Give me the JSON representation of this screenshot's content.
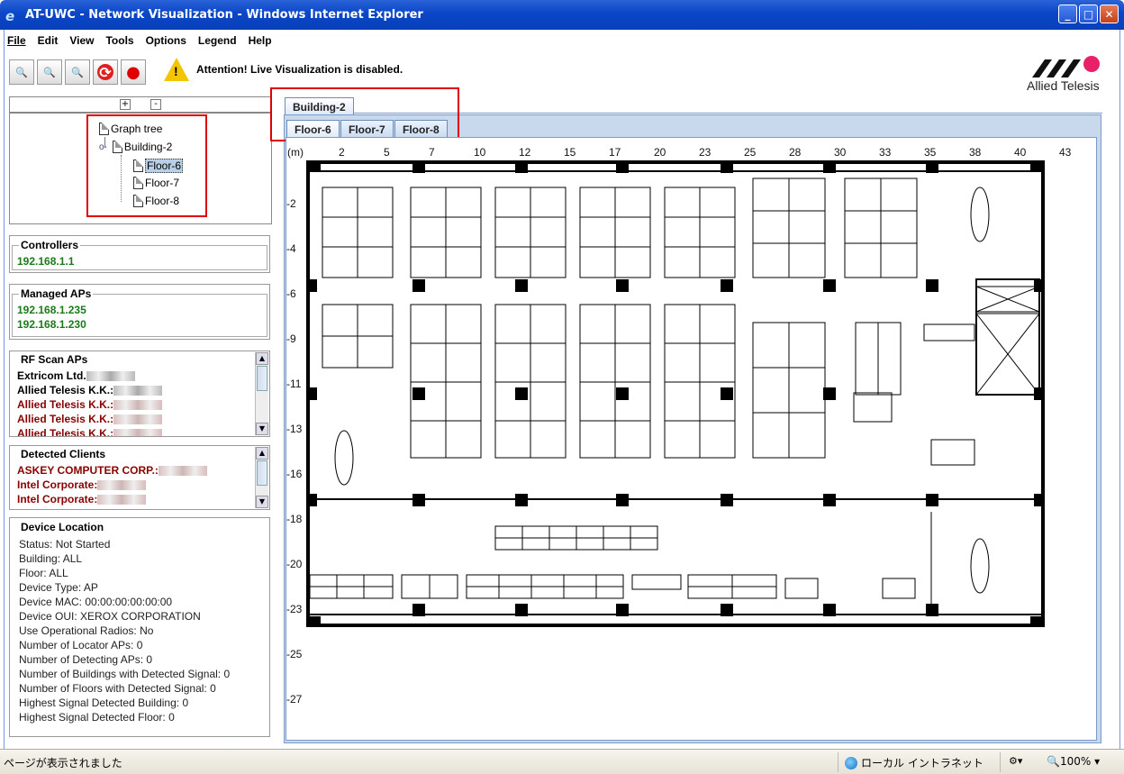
{
  "window": {
    "title": "AT-UWC - Network Visualization - Windows Internet Explorer"
  },
  "menu": [
    "File",
    "Edit",
    "View",
    "Tools",
    "Options",
    "Legend",
    "Help"
  ],
  "toolbar": {
    "buttons": [
      {
        "name": "zoom-in-icon",
        "glyph": "🔍"
      },
      {
        "name": "zoom-out-icon",
        "glyph": "🔍"
      },
      {
        "name": "zoom-fit-icon",
        "glyph": "🔍"
      },
      {
        "name": "refresh-icon",
        "glyph": "⟳"
      },
      {
        "name": "stop-icon",
        "glyph": "●"
      }
    ],
    "attention": "Attention! Live Visualization is disabled."
  },
  "brand": {
    "logo_text": "Allied Telesis"
  },
  "tree": {
    "plus": "+",
    "minus": "-",
    "root": "Graph tree",
    "building": "Building-2",
    "floors": [
      "Floor-6",
      "Floor-7",
      "Floor-8"
    ],
    "selected": "Floor-6"
  },
  "controllers": {
    "title": "Controllers",
    "items": [
      "192.168.1.1"
    ]
  },
  "managed_aps": {
    "title": "Managed APs",
    "items": [
      "192.168.1.235",
      "192.168.1.230"
    ]
  },
  "rf_scan_aps": {
    "title": "RF Scan APs",
    "items": [
      "Extricom Ltd.",
      "Allied Telesis K.K.:",
      "Allied Telesis K.K.:",
      "Allied Telesis K.K.:",
      "Allied Telesis K.K.:"
    ]
  },
  "detected_clients": {
    "title": "Detected Clients",
    "items": [
      "ASKEY COMPUTER CORP.:",
      "Intel Corporate:",
      "Intel Corporate:"
    ]
  },
  "device_location": {
    "title": "Device Location",
    "lines": [
      "Status: Not Started",
      "Building: ALL",
      "Floor: ALL",
      "Device Type: AP",
      "Device MAC: 00:00:00:00:00:00",
      "Device OUI: XEROX CORPORATION",
      "Use Operational Radios: No",
      "Number of Locator APs: 0",
      "Number of Detecting APs: 0",
      "Number of Buildings with Detected Signal: 0",
      "Number of Floors with Detected Signal: 0",
      "Highest Signal Detected Building: 0",
      "Highest Signal Detected Floor: 0"
    ]
  },
  "tabs": {
    "building": "Building-2",
    "floors": [
      "Floor-6",
      "Floor-7",
      "Floor-8"
    ],
    "active_floor": "Floor-6"
  },
  "ruler": {
    "unit": "(m)",
    "x_labels": [
      "2",
      "5",
      "7",
      "10",
      "12",
      "15",
      "17",
      "20",
      "23",
      "25",
      "28",
      "30",
      "33",
      "35",
      "38",
      "40",
      "43"
    ],
    "y_labels": [
      "-2",
      "-4",
      "-6",
      "-9",
      "-11",
      "-13",
      "-16",
      "-18",
      "-20",
      "-23",
      "-25",
      "-27"
    ]
  },
  "statusbar": {
    "left": "ページが表示されました",
    "zone": "ローカル イントラネット",
    "zoom": "100%"
  }
}
